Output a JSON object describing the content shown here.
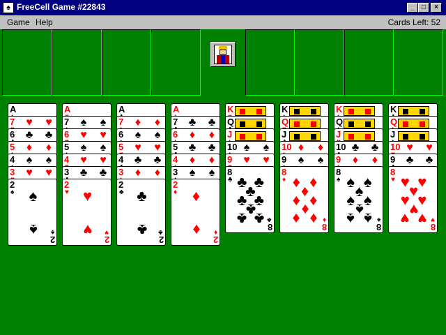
{
  "window": {
    "title": "FreeCell Game #22843",
    "icon": "freecell-app-icon",
    "controls": {
      "minimize": "_",
      "maximize": "□",
      "close": "×"
    }
  },
  "menu": {
    "items": [
      {
        "label": "Game",
        "name": "menu-game"
      },
      {
        "label": "Help",
        "name": "menu-help"
      }
    ],
    "cards_left": "Cards Left: 52"
  },
  "colors": {
    "felt": "#008000",
    "title_bar": "#000080",
    "red_suit": "#ff0000",
    "black_suit": "#000000"
  },
  "free_cells": [
    null,
    null,
    null,
    null
  ],
  "home_cells": [
    null,
    null,
    null,
    null
  ],
  "king_icon": "king-face-icon",
  "suits": {
    "S": "♠",
    "H": "♥",
    "C": "♣",
    "D": "♦"
  },
  "columns": [
    {
      "cards": [
        {
          "rank": "A",
          "suit": "S"
        },
        {
          "rank": "7",
          "suit": "H"
        },
        {
          "rank": "6",
          "suit": "C"
        },
        {
          "rank": "5",
          "suit": "D"
        },
        {
          "rank": "4",
          "suit": "S"
        },
        {
          "rank": "3",
          "suit": "H"
        },
        {
          "rank": "2",
          "suit": "S"
        }
      ]
    },
    {
      "cards": [
        {
          "rank": "A",
          "suit": "H"
        },
        {
          "rank": "7",
          "suit": "S"
        },
        {
          "rank": "6",
          "suit": "H"
        },
        {
          "rank": "5",
          "suit": "S"
        },
        {
          "rank": "4",
          "suit": "H"
        },
        {
          "rank": "3",
          "suit": "C"
        },
        {
          "rank": "2",
          "suit": "H"
        }
      ]
    },
    {
      "cards": [
        {
          "rank": "A",
          "suit": "C"
        },
        {
          "rank": "7",
          "suit": "D"
        },
        {
          "rank": "6",
          "suit": "S"
        },
        {
          "rank": "5",
          "suit": "H"
        },
        {
          "rank": "4",
          "suit": "C"
        },
        {
          "rank": "3",
          "suit": "D"
        },
        {
          "rank": "2",
          "suit": "C"
        }
      ]
    },
    {
      "cards": [
        {
          "rank": "A",
          "suit": "D"
        },
        {
          "rank": "7",
          "suit": "C"
        },
        {
          "rank": "6",
          "suit": "D"
        },
        {
          "rank": "5",
          "suit": "C"
        },
        {
          "rank": "4",
          "suit": "D"
        },
        {
          "rank": "3",
          "suit": "S"
        },
        {
          "rank": "2",
          "suit": "D"
        }
      ]
    },
    {
      "cards": [
        {
          "rank": "K",
          "suit": "H"
        },
        {
          "rank": "Q",
          "suit": "C"
        },
        {
          "rank": "J",
          "suit": "D"
        },
        {
          "rank": "10",
          "suit": "S"
        },
        {
          "rank": "9",
          "suit": "H"
        },
        {
          "rank": "8",
          "suit": "C"
        }
      ]
    },
    {
      "cards": [
        {
          "rank": "K",
          "suit": "S"
        },
        {
          "rank": "Q",
          "suit": "H"
        },
        {
          "rank": "J",
          "suit": "C"
        },
        {
          "rank": "10",
          "suit": "D"
        },
        {
          "rank": "9",
          "suit": "S"
        },
        {
          "rank": "8",
          "suit": "D"
        }
      ]
    },
    {
      "cards": [
        {
          "rank": "K",
          "suit": "D"
        },
        {
          "rank": "Q",
          "suit": "S"
        },
        {
          "rank": "J",
          "suit": "H"
        },
        {
          "rank": "10",
          "suit": "C"
        },
        {
          "rank": "9",
          "suit": "D"
        },
        {
          "rank": "8",
          "suit": "S"
        }
      ]
    },
    {
      "cards": [
        {
          "rank": "K",
          "suit": "C"
        },
        {
          "rank": "Q",
          "suit": "D"
        },
        {
          "rank": "J",
          "suit": "S"
        },
        {
          "rank": "10",
          "suit": "H"
        },
        {
          "rank": "9",
          "suit": "C"
        },
        {
          "rank": "8",
          "suit": "H"
        }
      ]
    }
  ]
}
